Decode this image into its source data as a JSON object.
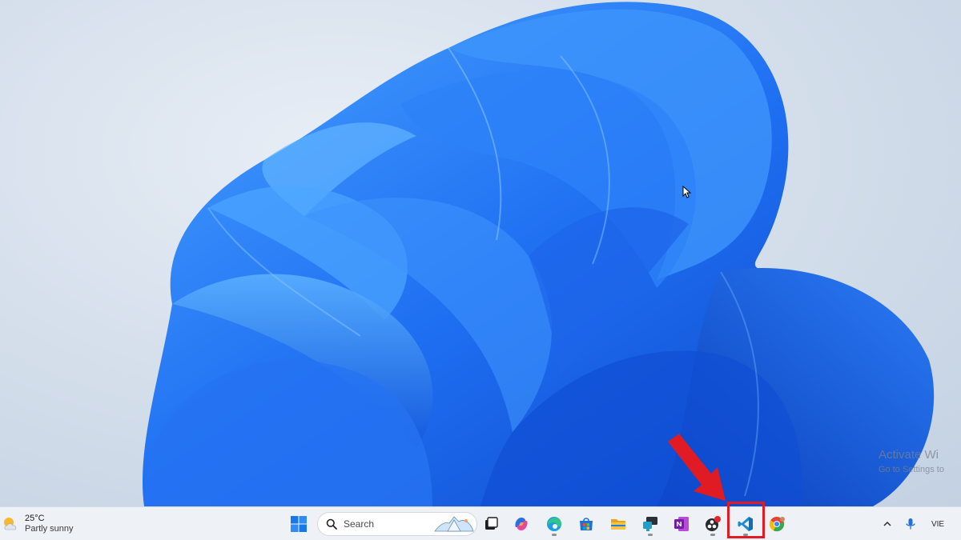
{
  "desktop": {
    "watermark": {
      "title": "Activate Wi",
      "subtitle": "Go to Settings to"
    }
  },
  "taskbar": {
    "weather": {
      "temperature": "25°C",
      "condition": "Partly sunny",
      "icon": "partly-sunny-icon"
    },
    "search": {
      "placeholder": "Search",
      "icon": "search-icon"
    },
    "apps": [
      {
        "name": "start",
        "icon": "windows-start-icon"
      },
      {
        "name": "task-view",
        "icon": "task-view-icon"
      },
      {
        "name": "copilot",
        "icon": "copilot-icon"
      },
      {
        "name": "edge",
        "icon": "edge-icon"
      },
      {
        "name": "store",
        "icon": "store-icon"
      },
      {
        "name": "file-explorer",
        "icon": "folder-icon"
      },
      {
        "name": "remote-desktop",
        "icon": "remote-desktop-icon"
      },
      {
        "name": "onenote",
        "icon": "onenote-icon"
      },
      {
        "name": "obs",
        "icon": "obs-icon"
      },
      {
        "name": "vs-code",
        "icon": "vscode-icon"
      },
      {
        "name": "chrome",
        "icon": "chrome-icon"
      }
    ],
    "tray": {
      "language": "VIE",
      "icons": [
        "chevron-up-icon",
        "microphone-icon"
      ]
    }
  },
  "annotation": {
    "highlight_color": "#e01b24",
    "highlighted_app": "vs-code"
  },
  "colors": {
    "wallpaper_blue": "#1a6ff0",
    "taskbar_bg": "#eef1f6",
    "vscode_blue": "#1f8ad2"
  }
}
